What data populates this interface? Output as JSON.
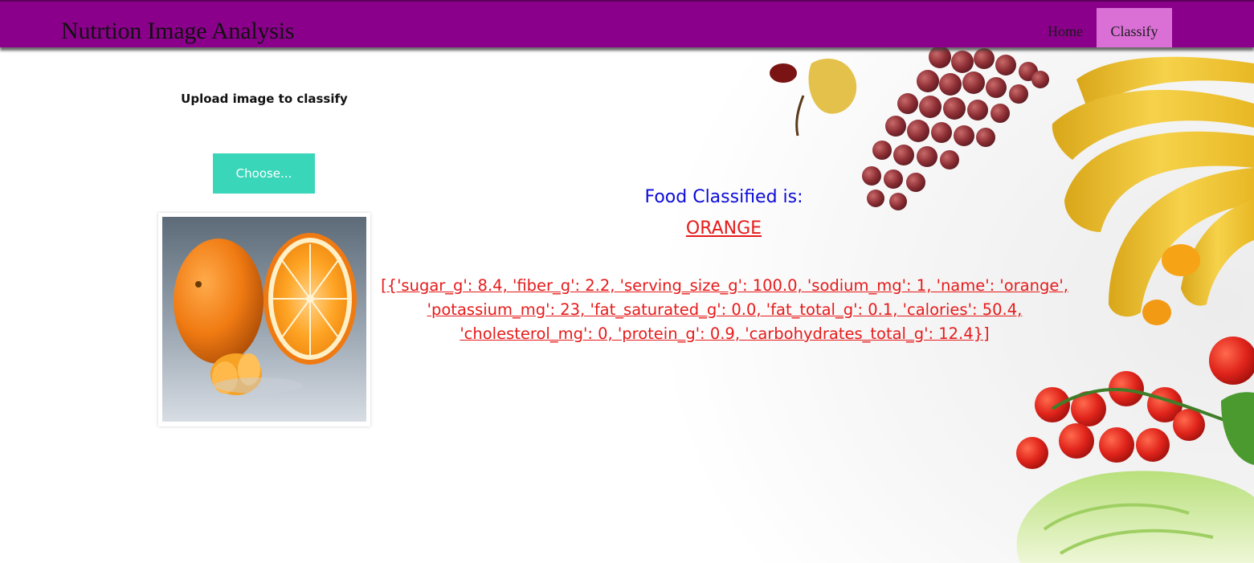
{
  "navbar": {
    "brand": "Nutrtion Image Analysis",
    "links": [
      {
        "label": "Home",
        "active": false
      },
      {
        "label": "Classify",
        "active": true
      }
    ],
    "bg_color": "#8b008b",
    "active_color": "#da70d6"
  },
  "upload": {
    "label": "Upload image to classify",
    "choose_button": "Choose...",
    "button_color": "#3ad6b9",
    "preview_icon": "orange-photo"
  },
  "result": {
    "title": "Food Classified is:",
    "food": "ORANGE",
    "nutrition_text": "[{'sugar_g': 8.4, 'fiber_g': 2.2, 'serving_size_g': 100.0, 'sodium_mg': 1, 'name': 'orange', 'potassium_mg': 23, 'fat_saturated_g': 0.0, 'fat_total_g': 0.1, 'calories': 50.4, 'cholesterol_mg': 0, 'protein_g': 0.9, 'carbohydrates_total_g': 12.4}]",
    "title_color": "#0b0bd9",
    "value_color": "#e61b1b"
  },
  "background": {
    "decoration_icon": "fruits-and-vegetables-illustration"
  }
}
